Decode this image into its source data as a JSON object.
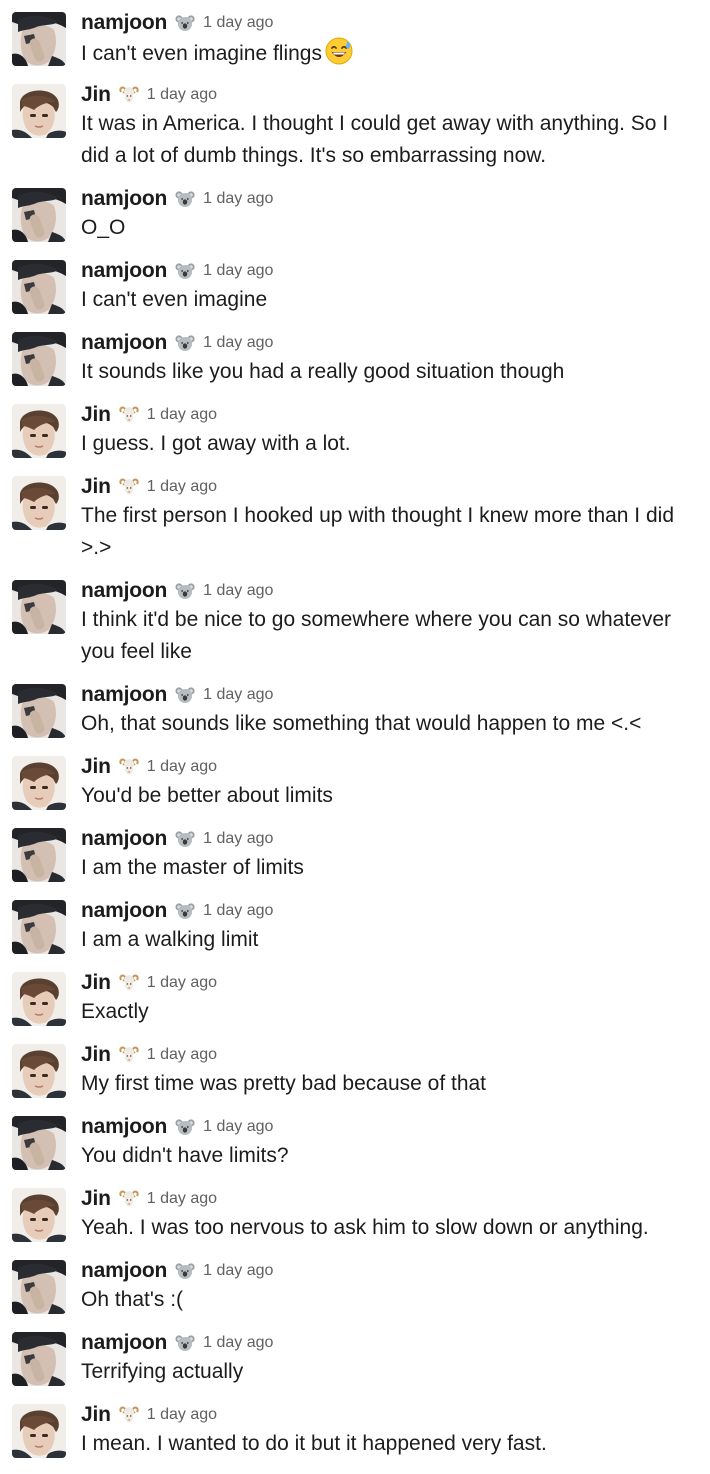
{
  "messages": [
    {
      "user": "namjoon",
      "time": "1 day ago",
      "text": "I can't even imagine flings",
      "inline_emoji": "sweat-smile-emoji",
      "tall": false
    },
    {
      "user": "Jin",
      "time": "1 day ago",
      "text": "It was in America. I thought I could get away with anything. So I did a lot of dumb things. It's so embarrassing now.",
      "tall": true
    },
    {
      "user": "namjoon",
      "time": "1 day ago",
      "text": "O_O",
      "tall": false
    },
    {
      "user": "namjoon",
      "time": "1 day ago",
      "text": "I can't even imagine",
      "tall": false
    },
    {
      "user": "namjoon",
      "time": "1 day ago",
      "text": "It sounds like you had a really good situation though",
      "tall": false
    },
    {
      "user": "Jin",
      "time": "1 day ago",
      "text": "I guess. I got away with a lot.",
      "tall": false
    },
    {
      "user": "Jin",
      "time": "1 day ago",
      "text": "The first person I hooked up with thought I knew more than I did >.>",
      "tall": true
    },
    {
      "user": "namjoon",
      "time": "1 day ago",
      "text": "I think it'd be nice to go somewhere where you can so whatever you feel like",
      "tall": true
    },
    {
      "user": "namjoon",
      "time": "1 day ago",
      "text": "Oh, that sounds like something that would happen to me <.<",
      "tall": false
    },
    {
      "user": "Jin",
      "time": "1 day ago",
      "text": "You'd be better about limits",
      "tall": false
    },
    {
      "user": "namjoon",
      "time": "1 day ago",
      "text": "I am the master of limits",
      "tall": false
    },
    {
      "user": "namjoon",
      "time": "1 day ago",
      "text": "I am a walking limit",
      "tall": false
    },
    {
      "user": "Jin",
      "time": "1 day ago",
      "text": "Exactly",
      "tall": false
    },
    {
      "user": "Jin",
      "time": "1 day ago",
      "text": "My first time was pretty bad because of that",
      "tall": false
    },
    {
      "user": "namjoon",
      "time": "1 day ago",
      "text": "You didn't have limits?",
      "tall": false
    },
    {
      "user": "Jin",
      "time": "1 day ago",
      "text": "Yeah. I was too nervous to ask him to slow down or anything.",
      "tall": false
    },
    {
      "user": "namjoon",
      "time": "1 day ago",
      "text": "Oh that's :(",
      "tall": false
    },
    {
      "user": "namjoon",
      "time": "1 day ago",
      "text": "Terrifying actually",
      "tall": false
    },
    {
      "user": "Jin",
      "time": "1 day ago",
      "text": "I mean. I wanted to do it but it happened very fast.",
      "tall": false
    }
  ],
  "users": {
    "namjoon": {
      "status_icon": "koala-icon",
      "avatar": "namjoon-avatar"
    },
    "Jin": {
      "status_icon": "ram-icon",
      "avatar": "jin-avatar"
    }
  },
  "colors": {
    "name": "#1d1c1d",
    "timestamp": "#616061",
    "text": "#1d1c1d"
  }
}
